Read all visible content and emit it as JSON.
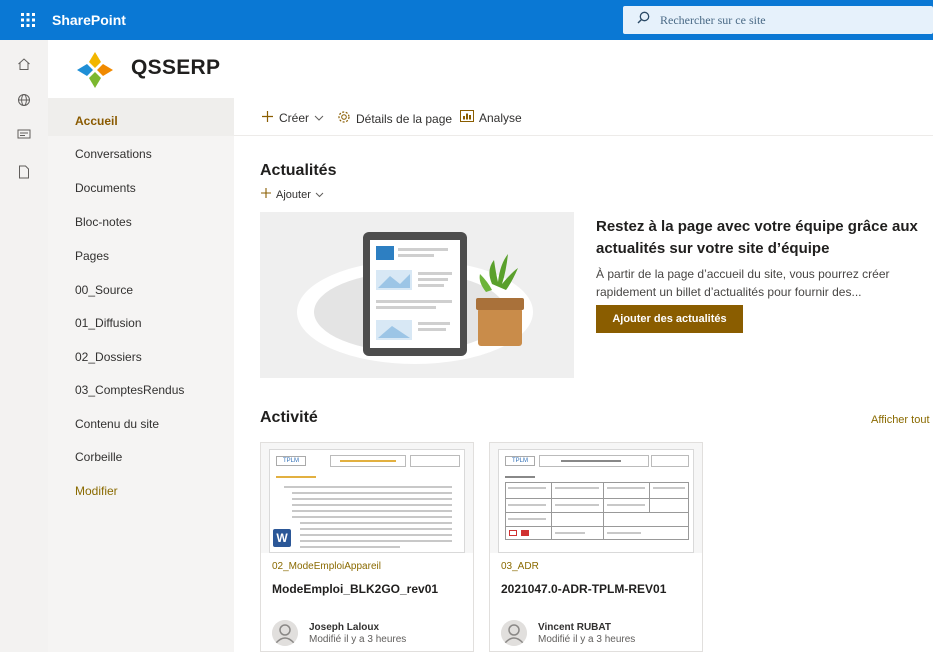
{
  "suite": {
    "app_name": "SharePoint",
    "search_placeholder": "Rechercher sur ce site"
  },
  "site": {
    "title": "QSSERP"
  },
  "leftnav": {
    "items": [
      {
        "label": "Accueil"
      },
      {
        "label": "Conversations"
      },
      {
        "label": "Documents"
      },
      {
        "label": "Bloc-notes"
      },
      {
        "label": "Pages"
      },
      {
        "label": "00_Source"
      },
      {
        "label": "01_Diffusion"
      },
      {
        "label": "02_Dossiers"
      },
      {
        "label": "03_ComptesRendus"
      },
      {
        "label": "Contenu du site"
      },
      {
        "label": "Corbeille"
      }
    ],
    "edit_label": "Modifier"
  },
  "commandbar": {
    "create_label": "Créer",
    "page_details_label": "Détails de la page",
    "analytics_label": "Analyse"
  },
  "news": {
    "heading": "Actualités",
    "add_label": "Ajouter",
    "promo_title": "Restez à la page avec votre équipe grâce aux actualités sur votre site d’équipe",
    "promo_text": "À partir de la page d’accueil du site, vous pourrez créer rapidement un billet d’actualités pour fournir des...",
    "promo_button": "Ajouter des actualités"
  },
  "activity": {
    "heading": "Activité",
    "show_all": "Afficher tout",
    "cards": [
      {
        "folder": "02_ModeEmploiAppareil",
        "title": "ModeEmploi_BLK2GO_rev01",
        "author": "Joseph Laloux",
        "modified": "Modifié il y a 3 heures"
      },
      {
        "folder": "03_ADR",
        "title": "2021047.0-ADR-TPLM-REV01",
        "author": "Vincent RUBAT",
        "modified": "Modifié il y a 3 heures"
      }
    ]
  },
  "colors": {
    "suite_bar": "#0a78d4",
    "accent": "#8a5d00",
    "link": "#8a6a00"
  }
}
